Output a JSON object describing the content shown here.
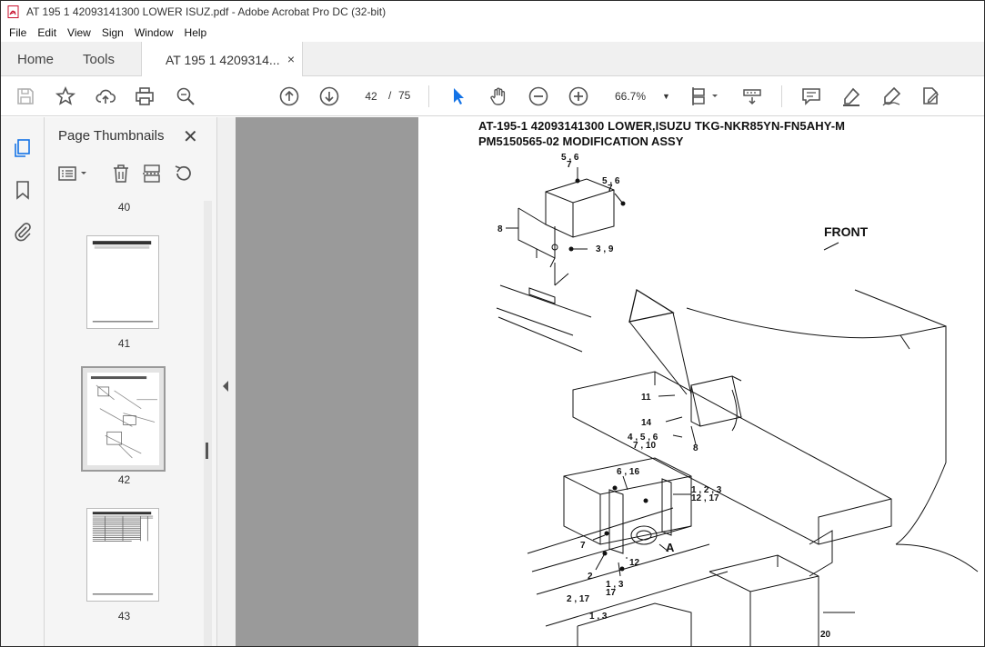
{
  "window": {
    "title": "AT 195 1 42093141300 LOWER ISUZ.pdf - Adobe Acrobat Pro DC (32-bit)"
  },
  "menu": [
    "File",
    "Edit",
    "View",
    "Sign",
    "Window",
    "Help"
  ],
  "tabs": {
    "home": "Home",
    "tools": "Tools",
    "document": "AT 195 1 4209314...",
    "close": "×"
  },
  "toolbar": {
    "page_current": "42",
    "page_separator": "/",
    "page_total": "75",
    "zoom": "66.7%"
  },
  "panel": {
    "title": "Page Thumbnails",
    "close": "✕",
    "thumbnails": [
      {
        "label": "40"
      },
      {
        "label": "41"
      },
      {
        "label": "42"
      },
      {
        "label": "43"
      }
    ]
  },
  "document": {
    "title_line1": "AT-195-1 42093141300 LOWER,ISUZU TKG-NKR85YN-FN5AHY-M",
    "title_line2": "PM5150565-02 MODIFICATION ASSY",
    "front_label": "FRONT",
    "callouts": {
      "c1": "5 , 6",
      "c1b": "7",
      "c2": "5 , 6",
      "c2b": "7",
      "c3": "8",
      "c4": "3 , 9",
      "c5": "11",
      "c6": "14",
      "c7": "4 , 5 , 6",
      "c7b": "7 , 10",
      "c8": "8",
      "c9": "6 , 16",
      "c10": "1 , 2 , 3",
      "c10b": "12 , 17",
      "c11": "7",
      "c12": "A",
      "c13": "2",
      "c14": "12",
      "c15": "1 , 3",
      "c15b": "17",
      "c16": "2 , 17",
      "c17": "1 , 3",
      "c18": "20"
    }
  }
}
